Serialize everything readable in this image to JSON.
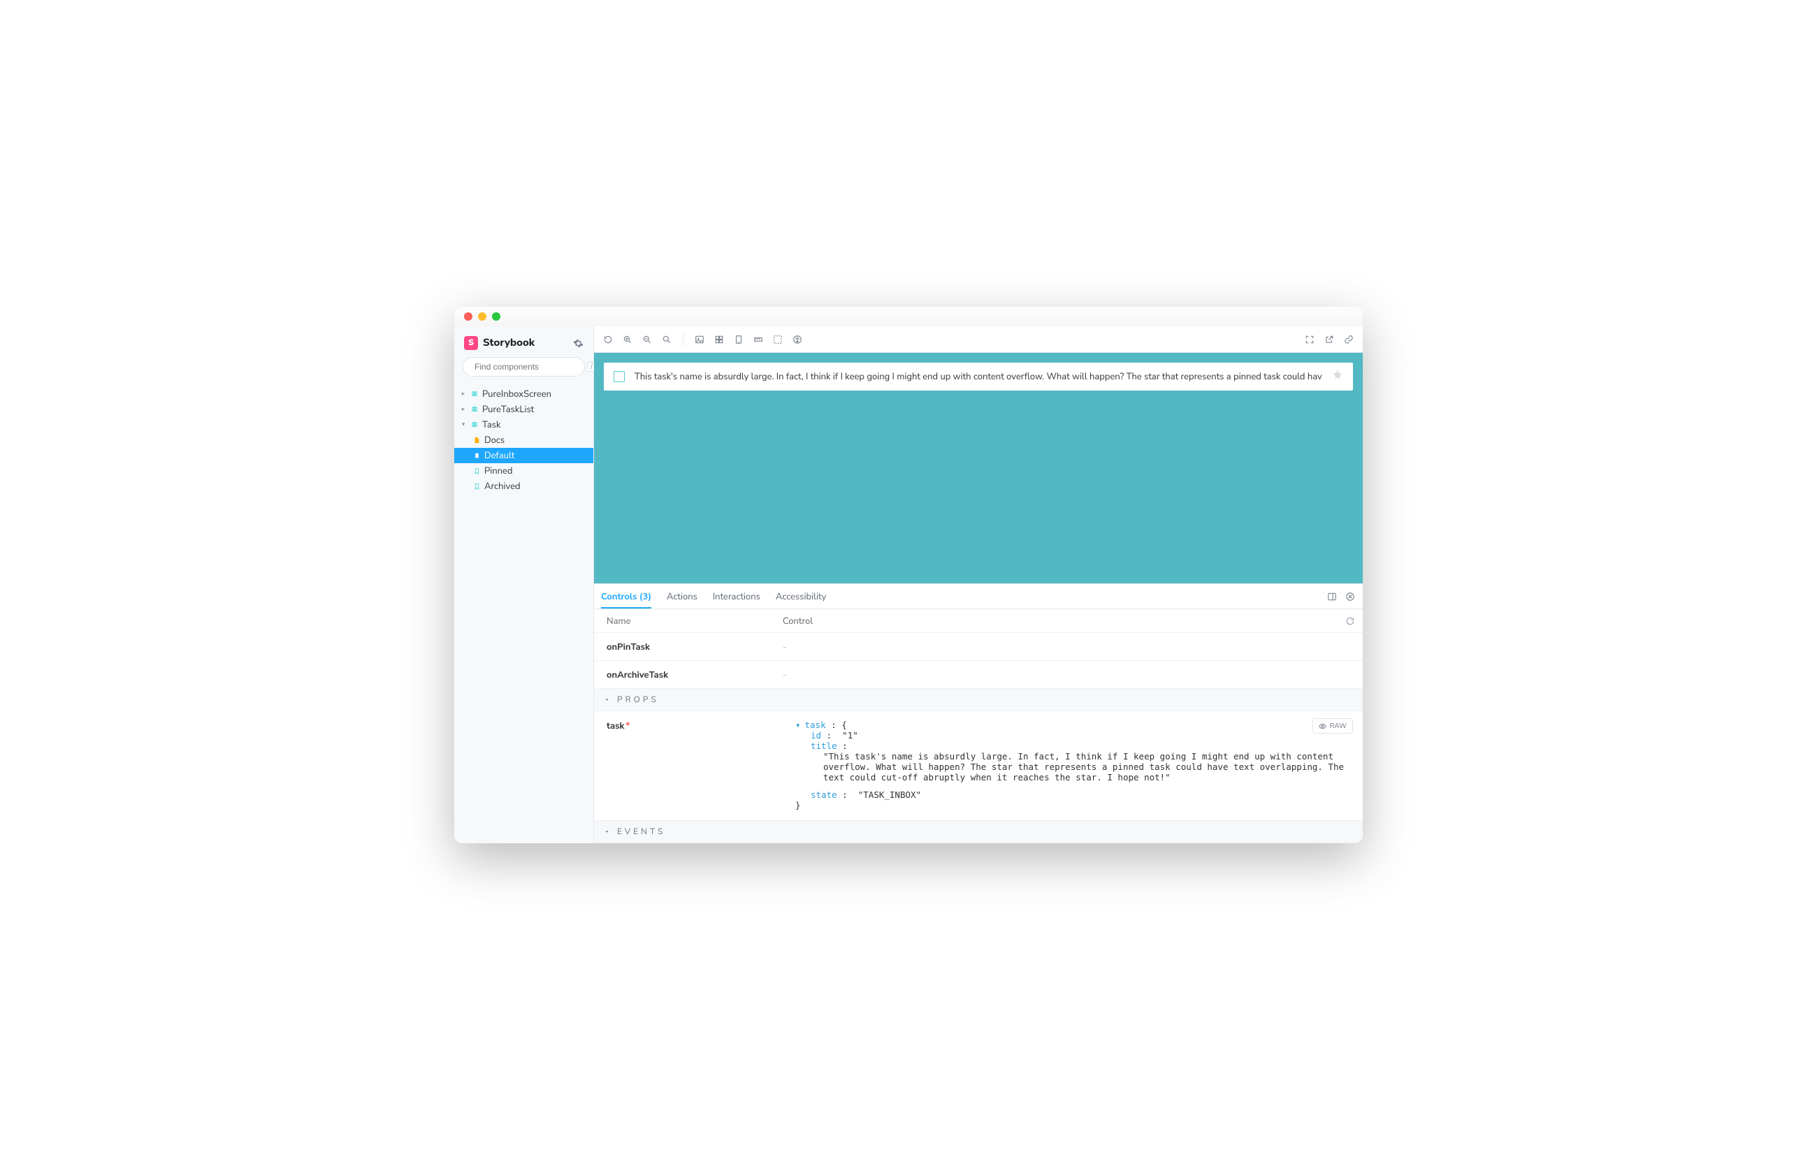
{
  "brand": {
    "name": "Storybook",
    "badge": "S"
  },
  "search": {
    "placeholder": "Find components",
    "shortcut": "/"
  },
  "tree": {
    "items": [
      {
        "label": "PureInboxScreen",
        "expanded": false,
        "kind": "component"
      },
      {
        "label": "PureTaskList",
        "expanded": false,
        "kind": "component"
      },
      {
        "label": "Task",
        "expanded": true,
        "kind": "component",
        "children": [
          {
            "label": "Docs",
            "kind": "doc",
            "active": false
          },
          {
            "label": "Default",
            "kind": "story",
            "active": true
          },
          {
            "label": "Pinned",
            "kind": "story",
            "active": false
          },
          {
            "label": "Archived",
            "kind": "story",
            "active": false
          }
        ]
      }
    ]
  },
  "toolbar": {
    "left": [
      "refresh",
      "zoom-in",
      "zoom-out",
      "zoom-reset",
      "photo",
      "grid",
      "tablet",
      "ruler",
      "outline",
      "a11y"
    ],
    "right": [
      "fullscreen",
      "open-new",
      "link"
    ]
  },
  "canvas": {
    "task_title": "This task's name is absurdly large. In fact, I think if I keep going I might end up with content overflow. What will happen? The star that represents a pinned task could have text"
  },
  "addons": {
    "tabs": [
      {
        "label": "Controls (3)",
        "active": true
      },
      {
        "label": "Actions",
        "active": false
      },
      {
        "label": "Interactions",
        "active": false
      },
      {
        "label": "Accessibility",
        "active": false
      }
    ],
    "table": {
      "name_header": "Name",
      "control_header": "Control",
      "rows": [
        {
          "name": "onPinTask",
          "control": "-"
        },
        {
          "name": "onArchiveTask",
          "control": "-"
        }
      ]
    },
    "sections": {
      "props": "Props",
      "events": "Events"
    },
    "task_control": {
      "name": "task",
      "required": true,
      "raw_label": "RAW",
      "object": {
        "task_label": "task",
        "id_key": "id",
        "id_val": "\"1\"",
        "title_key": "title",
        "title_val": "\"This task's name is absurdly large. In fact, I think if I keep going I might end up with content overflow. What will happen? The star that represents a pinned task could have text overlapping. The text could cut-off abruptly when it reaches the star. I hope not!\"",
        "state_key": "state",
        "state_val": "\"TASK_INBOX\""
      }
    }
  }
}
